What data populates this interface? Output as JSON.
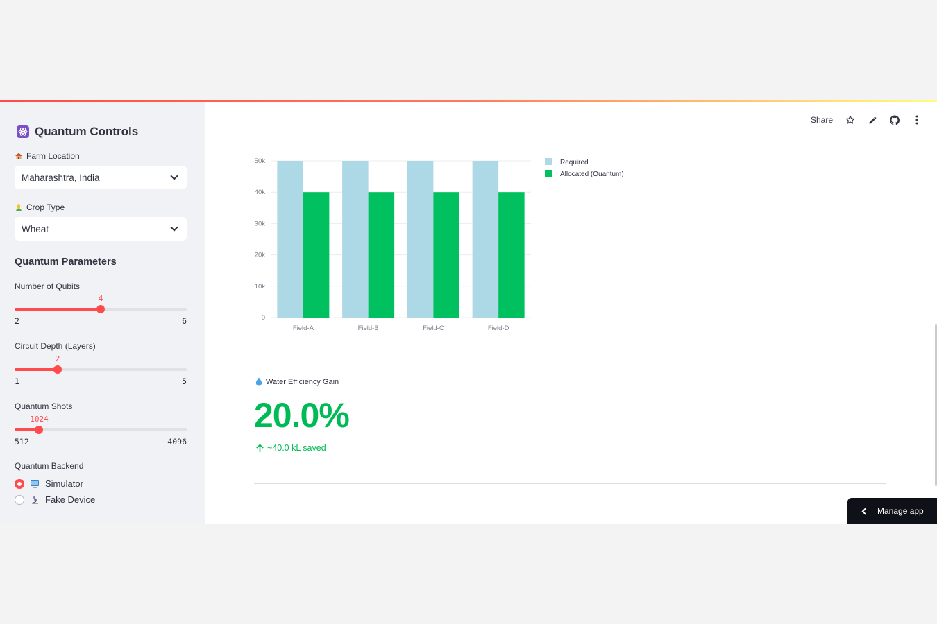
{
  "sidebar": {
    "title": "Quantum Controls",
    "farm_location": {
      "label": "Farm Location",
      "value": "Maharashtra, India"
    },
    "crop_type": {
      "label": "Crop Type",
      "value": "Wheat"
    },
    "params_heading": "Quantum Parameters",
    "qubits": {
      "label": "Number of Qubits",
      "value": "4",
      "min": "2",
      "max": "6",
      "fraction": 0.5
    },
    "depth": {
      "label": "Circuit Depth (Layers)",
      "value": "2",
      "min": "1",
      "max": "5",
      "fraction": 0.25
    },
    "shots": {
      "label": "Quantum Shots",
      "value": "1024",
      "min": "512",
      "max": "4096",
      "fraction": 0.143
    },
    "backend": {
      "label": "Quantum Backend",
      "options": [
        "Simulator",
        "Fake Device"
      ],
      "selected": "Simulator"
    }
  },
  "toolbar": {
    "share_label": "Share"
  },
  "chart_data": {
    "type": "bar",
    "categories": [
      "Field-A",
      "Field-B",
      "Field-C",
      "Field-D"
    ],
    "series": [
      {
        "name": "Required",
        "values": [
          50000,
          50000,
          50000,
          50000
        ],
        "color": "#add8e6"
      },
      {
        "name": "Allocated (Quantum)",
        "values": [
          40000,
          40000,
          40000,
          40000
        ],
        "color": "#00c060"
      }
    ],
    "yticks": [
      "0",
      "10k",
      "20k",
      "30k",
      "40k",
      "50k"
    ],
    "ylim": [
      0,
      50000
    ],
    "grid": true,
    "legend": "top-right"
  },
  "metric": {
    "label": "Water Efficiency Gain",
    "value": "20.0%",
    "delta": "~40.0 kL saved"
  },
  "manage_app": {
    "label": "Manage app"
  },
  "colors": {
    "accent": "#ff4b4b",
    "positive": "#00bb55"
  }
}
